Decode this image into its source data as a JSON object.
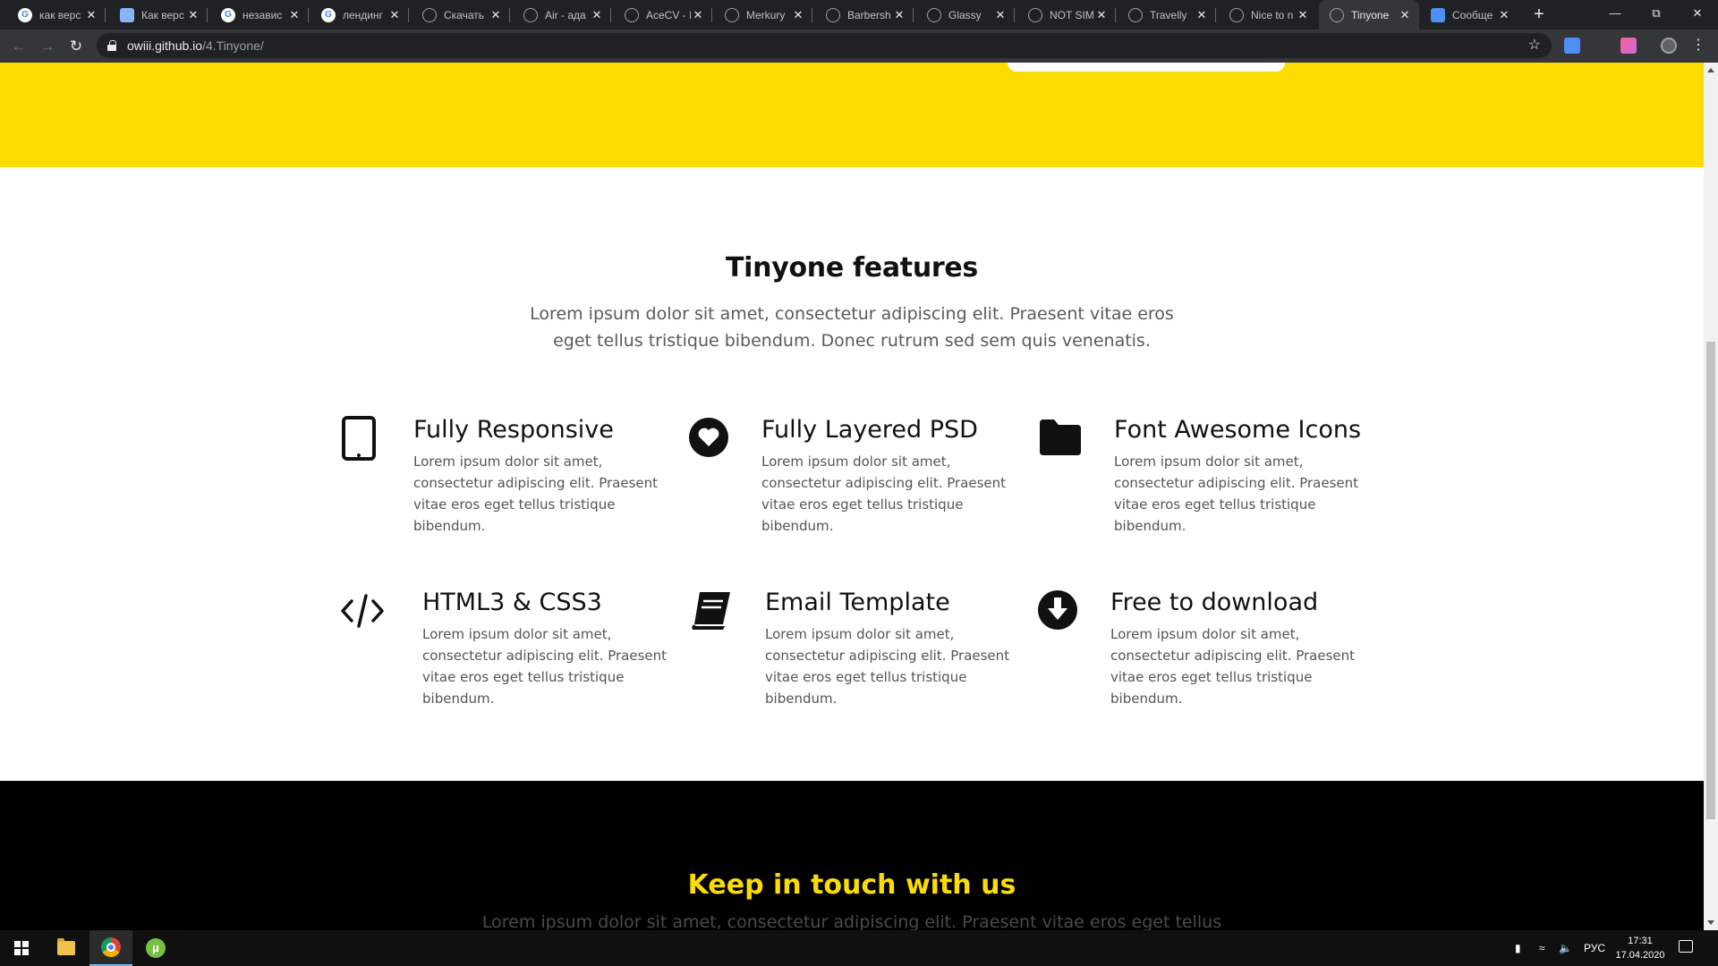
{
  "browser": {
    "tabs": [
      {
        "label": "как верс",
        "icon": "google"
      },
      {
        "label": "Как верс",
        "icon": "doc"
      },
      {
        "label": "независ",
        "icon": "google"
      },
      {
        "label": "лендинг",
        "icon": "google"
      },
      {
        "label": "Скачать",
        "icon": "globe"
      },
      {
        "label": "Air - ада",
        "icon": "globe"
      },
      {
        "label": "AceCV - I",
        "icon": "globe"
      },
      {
        "label": "Merkury",
        "icon": "globe"
      },
      {
        "label": "Barbersh",
        "icon": "globe"
      },
      {
        "label": "Glassy",
        "icon": "globe"
      },
      {
        "label": "NOT SIM",
        "icon": "globe"
      },
      {
        "label": "Travelly",
        "icon": "globe"
      },
      {
        "label": "Nice to n",
        "icon": "globe"
      },
      {
        "label": "Tinyone",
        "icon": "globe",
        "active": true
      },
      {
        "label": "Сообще",
        "icon": "chat"
      }
    ],
    "new_tab": "+",
    "url_host": "owiii.github.io",
    "url_path": "/4.Tinyone/"
  },
  "page": {
    "features_title": "Tinyone features",
    "features_subtitle": "Lorem ipsum dolor sit amet, consectetur adipiscing elit. Praesent vitae eros eget tellus tristique bibendum. Donec rutrum sed sem quis venenatis.",
    "features": [
      {
        "title": "Fully Responsive",
        "desc": "Lorem ipsum dolor sit amet, consectetur adipiscing elit. Praesent vitae eros eget tellus tristique bibendum.",
        "icon": "tablet-icon"
      },
      {
        "title": "Fully Layered PSD",
        "desc": "Lorem ipsum dolor sit amet, consectetur adipiscing elit. Praesent vitae eros eget tellus tristique bibendum.",
        "icon": "heart-icon"
      },
      {
        "title": "Font Awesome Icons",
        "desc": "Lorem ipsum dolor sit amet, consectetur adipiscing elit. Praesent vitae eros eget tellus tristique bibendum.",
        "icon": "folder-icon"
      },
      {
        "title": "HTML3 & CSS3",
        "desc": "Lorem ipsum dolor sit amet, consectetur adipiscing elit. Praesent vitae eros eget tellus tristique bibendum.",
        "icon": "code-icon"
      },
      {
        "title": "Email Template",
        "desc": "Lorem ipsum dolor sit amet, consectetur adipiscing elit. Praesent vitae eros eget tellus tristique bibendum.",
        "icon": "book-icon"
      },
      {
        "title": "Free to download",
        "desc": "Lorem ipsum dolor sit amet, consectetur adipiscing elit. Praesent vitae eros eget tellus tristique bibendum.",
        "icon": "download-icon"
      }
    ],
    "contact_title": "Keep in touch with us",
    "contact_subtitle": "Lorem ipsum dolor sit amet, consectetur adipiscing elit. Praesent vitae eros eget tellus"
  },
  "taskbar": {
    "language": "РУС",
    "time": "17:31",
    "date": "17.04.2020"
  },
  "colors": {
    "accent_yellow": "#fcdc00",
    "dark": "#000000"
  }
}
